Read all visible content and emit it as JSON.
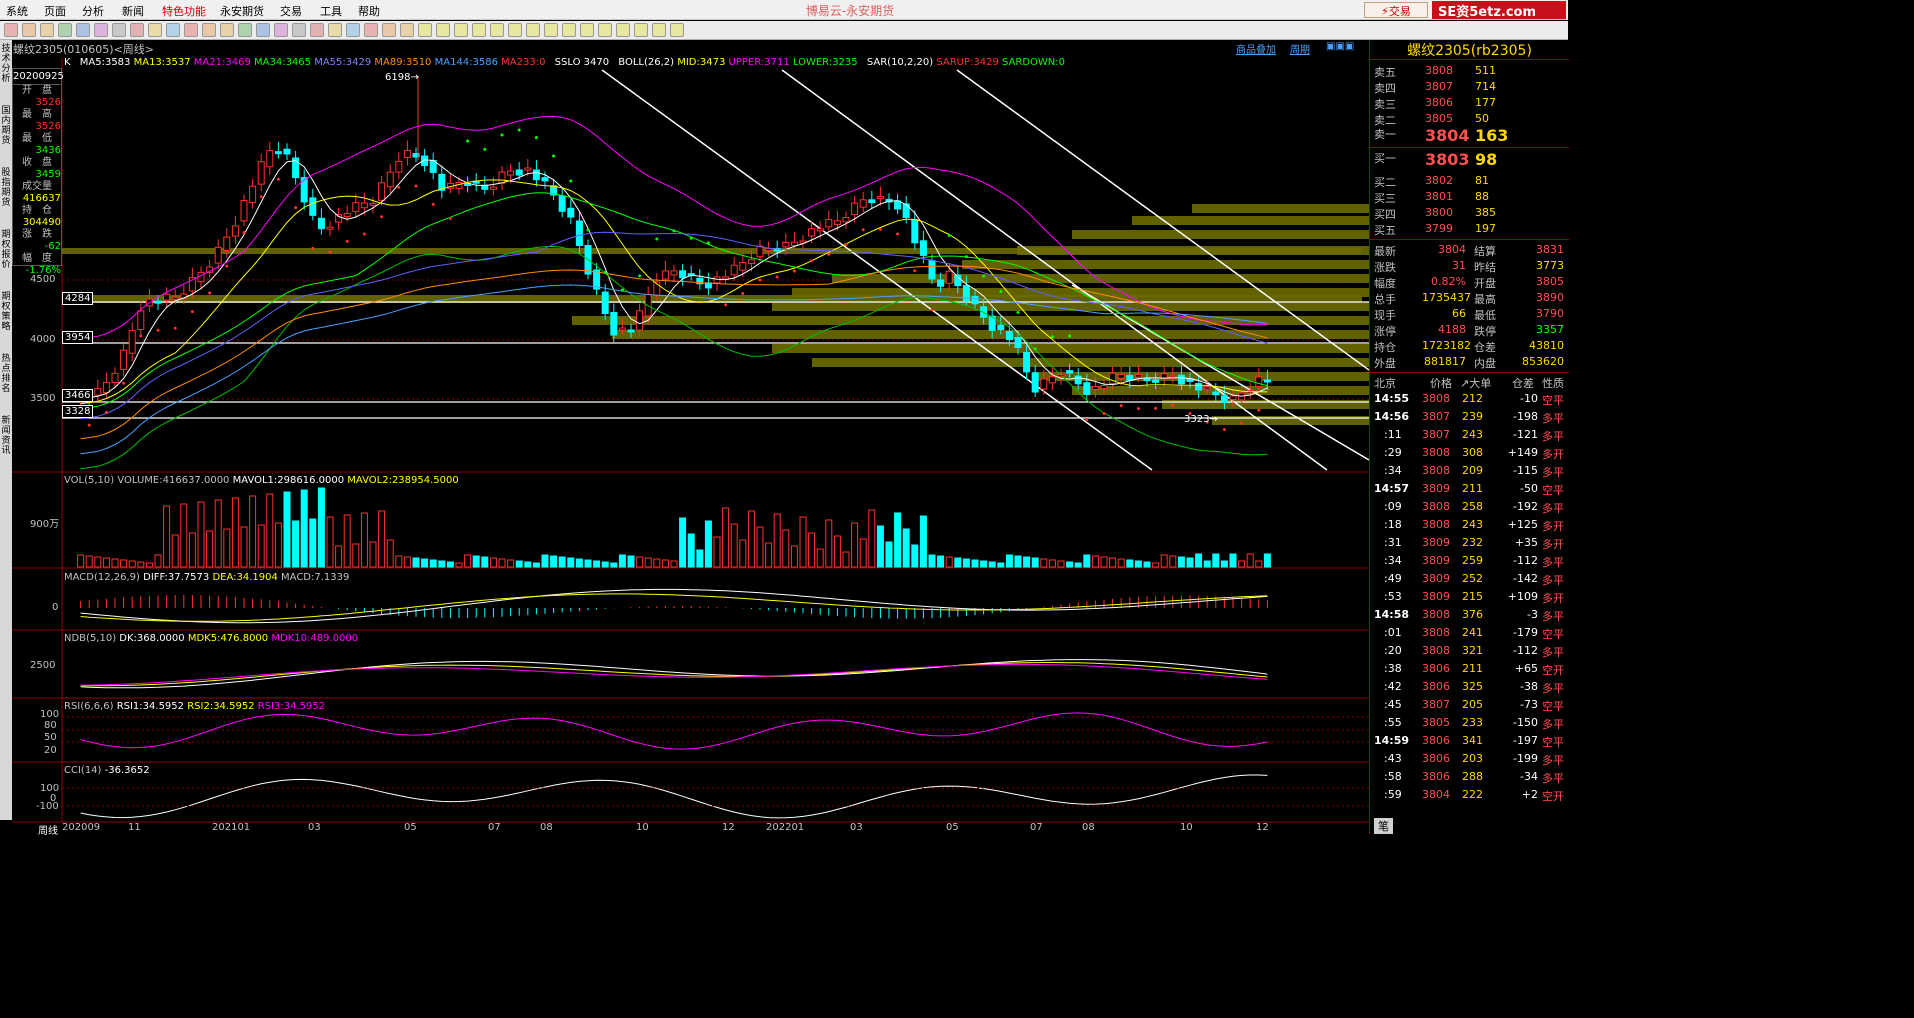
{
  "menu": {
    "items": [
      "系统",
      "页面",
      "分析",
      "新闻",
      "特色功能",
      "永安期货",
      "交易",
      "工具",
      "帮助"
    ],
    "app_title": "博易云-永安期货",
    "trade": "交易",
    "brand": "SE资5etz.com"
  },
  "left_tabs": [
    "技术分析",
    "国内期货",
    "股指期货",
    "期权报价",
    "期权策略",
    "热点排名",
    "新闻资讯"
  ],
  "instrument": {
    "name": "螺纹2305(010605)<周线>",
    "right_links": [
      "商品叠加",
      "周期"
    ]
  },
  "info": {
    "date": "20200925",
    "open_lbl": "开　盘",
    "open": "3526",
    "high_lbl": "最　高",
    "high": "3526",
    "low_lbl": "最　低",
    "low": "3436",
    "close_lbl": "收　盘",
    "close": "3459",
    "vol_lbl": "成交量",
    "vol": "416637",
    "oi_lbl": "持　仓",
    "oi": "304490",
    "chg_lbl": "涨　跌",
    "chg": "-62",
    "pct_lbl": "幅　度",
    "pct": "-1.76%"
  },
  "ma_line": {
    "k": "K",
    "ma5": "MA5:3583",
    "ma13": "MA13:3537",
    "ma21": "MA21:3469",
    "ma34": "MA34:3465",
    "ma55": "MA55:3429",
    "ma89": "MA89:3510",
    "ma144": "MA144:3586",
    "ma233": "MA233:0",
    "sslo": "SSLO 3470",
    "boll": "BOLL(26,2)",
    "mid": "MID:3473",
    "upper": "UPPER:3711",
    "lower": "LOWER:3235",
    "sar": "SAR(10,2,20)",
    "sarup": "SARUP:3429",
    "sardown": "SARDOWN:0"
  },
  "price_axis": [
    "4500",
    "4000",
    "3500"
  ],
  "hlines": [
    "4284",
    "3954",
    "3466",
    "3328"
  ],
  "peak_label": "6198→",
  "low_label": "3323→",
  "vol": {
    "title": "VOL(5,10)",
    "volume": "VOLUME:416637.0000",
    "mavol1": "MAVOL1:298616.0000",
    "mavol2": "MAVOL2:238954.5000",
    "axis": "900万"
  },
  "macd": {
    "title": "MACD(12,26,9)",
    "diff": "DIFF:37.7573",
    "dea": "DEA:34.1904",
    "macd": "MACD:7.1339",
    "axis": "0"
  },
  "ndb": {
    "title": "NDB(5,10)",
    "dk": "DK:368.0000",
    "mdk5": "MDK5:476.8000",
    "mdk10": "MDK10:489.0000",
    "axis": "2500"
  },
  "rsi": {
    "title": "RSI(6,6,6)",
    "rsi1": "RSI1:34.5952",
    "rsi2": "RSI2:34.5952",
    "rsi3": "RSI3:34.5952",
    "axis": [
      "100",
      "80",
      "50",
      "20"
    ]
  },
  "cci": {
    "title": "CCI(14)",
    "value": "-36.3652",
    "axis": [
      "100",
      "0",
      "-100"
    ]
  },
  "xaxis": {
    "label": "周线",
    "ticks": [
      "202009",
      "11",
      "202101",
      "03",
      "05",
      "07",
      "08",
      "10",
      "12",
      "202201",
      "03",
      "05",
      "07",
      "08",
      "10",
      "12"
    ]
  },
  "right": {
    "title": "螺纹2305(rb2305)",
    "asks": [
      {
        "l": "卖五",
        "p": "3808",
        "v": "511"
      },
      {
        "l": "卖四",
        "p": "3807",
        "v": "714"
      },
      {
        "l": "卖三",
        "p": "3806",
        "v": "177"
      },
      {
        "l": "卖二",
        "p": "3805",
        "v": "50"
      }
    ],
    "ask1": {
      "l": "卖一",
      "p": "3804",
      "v": "163"
    },
    "bid1": {
      "l": "买一",
      "p": "3803",
      "v": "98"
    },
    "bids": [
      {
        "l": "买二",
        "p": "3802",
        "v": "81"
      },
      {
        "l": "买三",
        "p": "3801",
        "v": "88"
      },
      {
        "l": "买四",
        "p": "3800",
        "v": "385"
      },
      {
        "l": "买五",
        "p": "3799",
        "v": "197"
      }
    ],
    "quotes": [
      {
        "l1": "最新",
        "v1": "3804",
        "l2": "结算",
        "v2": "3831"
      },
      {
        "l1": "涨跌",
        "v1": "31",
        "l2": "昨结",
        "v2": "3773"
      },
      {
        "l1": "幅度",
        "v1": "0.82%",
        "l2": "开盘",
        "v2": "3805"
      },
      {
        "l1": "总手",
        "v1": "1735437",
        "l2": "最高",
        "v2": "3890"
      },
      {
        "l1": "现手",
        "v1": "66",
        "l2": "最低",
        "v2": "3790"
      },
      {
        "l1": "涨停",
        "v1": "4188",
        "l2": "跌停",
        "v2": "3357"
      },
      {
        "l1": "持仓",
        "v1": "1723182",
        "l2": "仓差",
        "v2": "43810"
      },
      {
        "l1": "外盘",
        "v1": "881817",
        "l2": "内盘",
        "v2": "853620"
      }
    ],
    "tick_header": [
      "北京",
      "价格",
      "↗大单",
      "仓差",
      "性质"
    ],
    "ticks": [
      {
        "t": "14:55",
        "p": "3808",
        "v": "212",
        "d": "-10",
        "n": "空平"
      },
      {
        "t": "14:56",
        "p": "3807",
        "v": "239",
        "d": "-198",
        "n": "多平"
      },
      {
        "t": ":11",
        "p": "3807",
        "v": "243",
        "d": "-121",
        "n": "多平"
      },
      {
        "t": ":29",
        "p": "3808",
        "v": "308",
        "d": "+149",
        "n": "多开"
      },
      {
        "t": ":34",
        "p": "3808",
        "v": "209",
        "d": "-115",
        "n": "多平"
      },
      {
        "t": "14:57",
        "p": "3809",
        "v": "211",
        "d": "-50",
        "n": "空平"
      },
      {
        "t": ":09",
        "p": "3808",
        "v": "258",
        "d": "-192",
        "n": "多平"
      },
      {
        "t": ":18",
        "p": "3808",
        "v": "243",
        "d": "+125",
        "n": "多开"
      },
      {
        "t": ":31",
        "p": "3809",
        "v": "232",
        "d": "+35",
        "n": "多开"
      },
      {
        "t": ":34",
        "p": "3809",
        "v": "259",
        "d": "-112",
        "n": "多平"
      },
      {
        "t": ":49",
        "p": "3809",
        "v": "252",
        "d": "-142",
        "n": "多平"
      },
      {
        "t": ":53",
        "p": "3809",
        "v": "215",
        "d": "+109",
        "n": "多开"
      },
      {
        "t": "14:58",
        "p": "3808",
        "v": "376",
        "d": "-3",
        "n": "多平"
      },
      {
        "t": ":01",
        "p": "3808",
        "v": "241",
        "d": "-179",
        "n": "空平"
      },
      {
        "t": ":20",
        "p": "3808",
        "v": "321",
        "d": "-112",
        "n": "多平"
      },
      {
        "t": ":38",
        "p": "3806",
        "v": "211",
        "d": "+65",
        "n": "空开"
      },
      {
        "t": ":42",
        "p": "3806",
        "v": "325",
        "d": "-38",
        "n": "多平"
      },
      {
        "t": ":45",
        "p": "3807",
        "v": "205",
        "d": "-73",
        "n": "空平"
      },
      {
        "t": ":55",
        "p": "3805",
        "v": "233",
        "d": "-150",
        "n": "多平"
      },
      {
        "t": "14:59",
        "p": "3806",
        "v": "341",
        "d": "-197",
        "n": "空平"
      },
      {
        "t": ":43",
        "p": "3806",
        "v": "203",
        "d": "-199",
        "n": "多平"
      },
      {
        "t": ":58",
        "p": "3806",
        "v": "288",
        "d": "-34",
        "n": "多平"
      },
      {
        "t": ":59",
        "p": "3804",
        "v": "222",
        "d": "+2",
        "n": "空开"
      }
    ],
    "bottom": "笔"
  },
  "colors": {
    "up": "#ff3030",
    "down": "#00ffff",
    "grid": "#8b0000",
    "ma5": "#ffffff",
    "ma13": "#ffff00",
    "ma21": "#ff00ff",
    "ma34": "#00ff00",
    "ma55": "#6060ff",
    "ma89": "#ff8c00",
    "ma144": "#4aa0ff",
    "yellowtext": "#ffd700"
  }
}
